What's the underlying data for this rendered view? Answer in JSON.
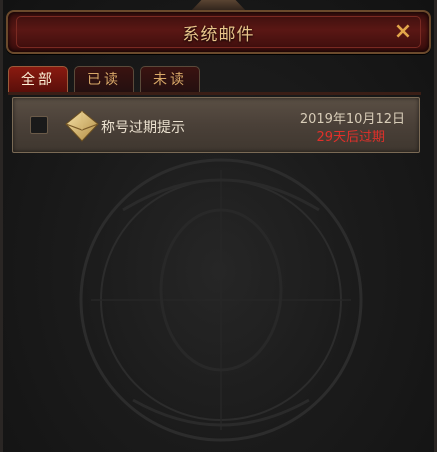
{
  "window": {
    "title": "系统邮件",
    "close_icon": "×"
  },
  "tabs": [
    {
      "label": "全部",
      "active": true
    },
    {
      "label": "已读",
      "active": false
    },
    {
      "label": "未读",
      "active": false
    }
  ],
  "mails": [
    {
      "icon": "envelope-icon",
      "subject": "称号过期提示",
      "date": "2019年10月12日",
      "expiry": "29天后过期",
      "checked": false
    }
  ],
  "colors": {
    "title_text": "#e8c48a",
    "expiry_text": "#e0302a",
    "active_tab": "#8a1a10"
  }
}
